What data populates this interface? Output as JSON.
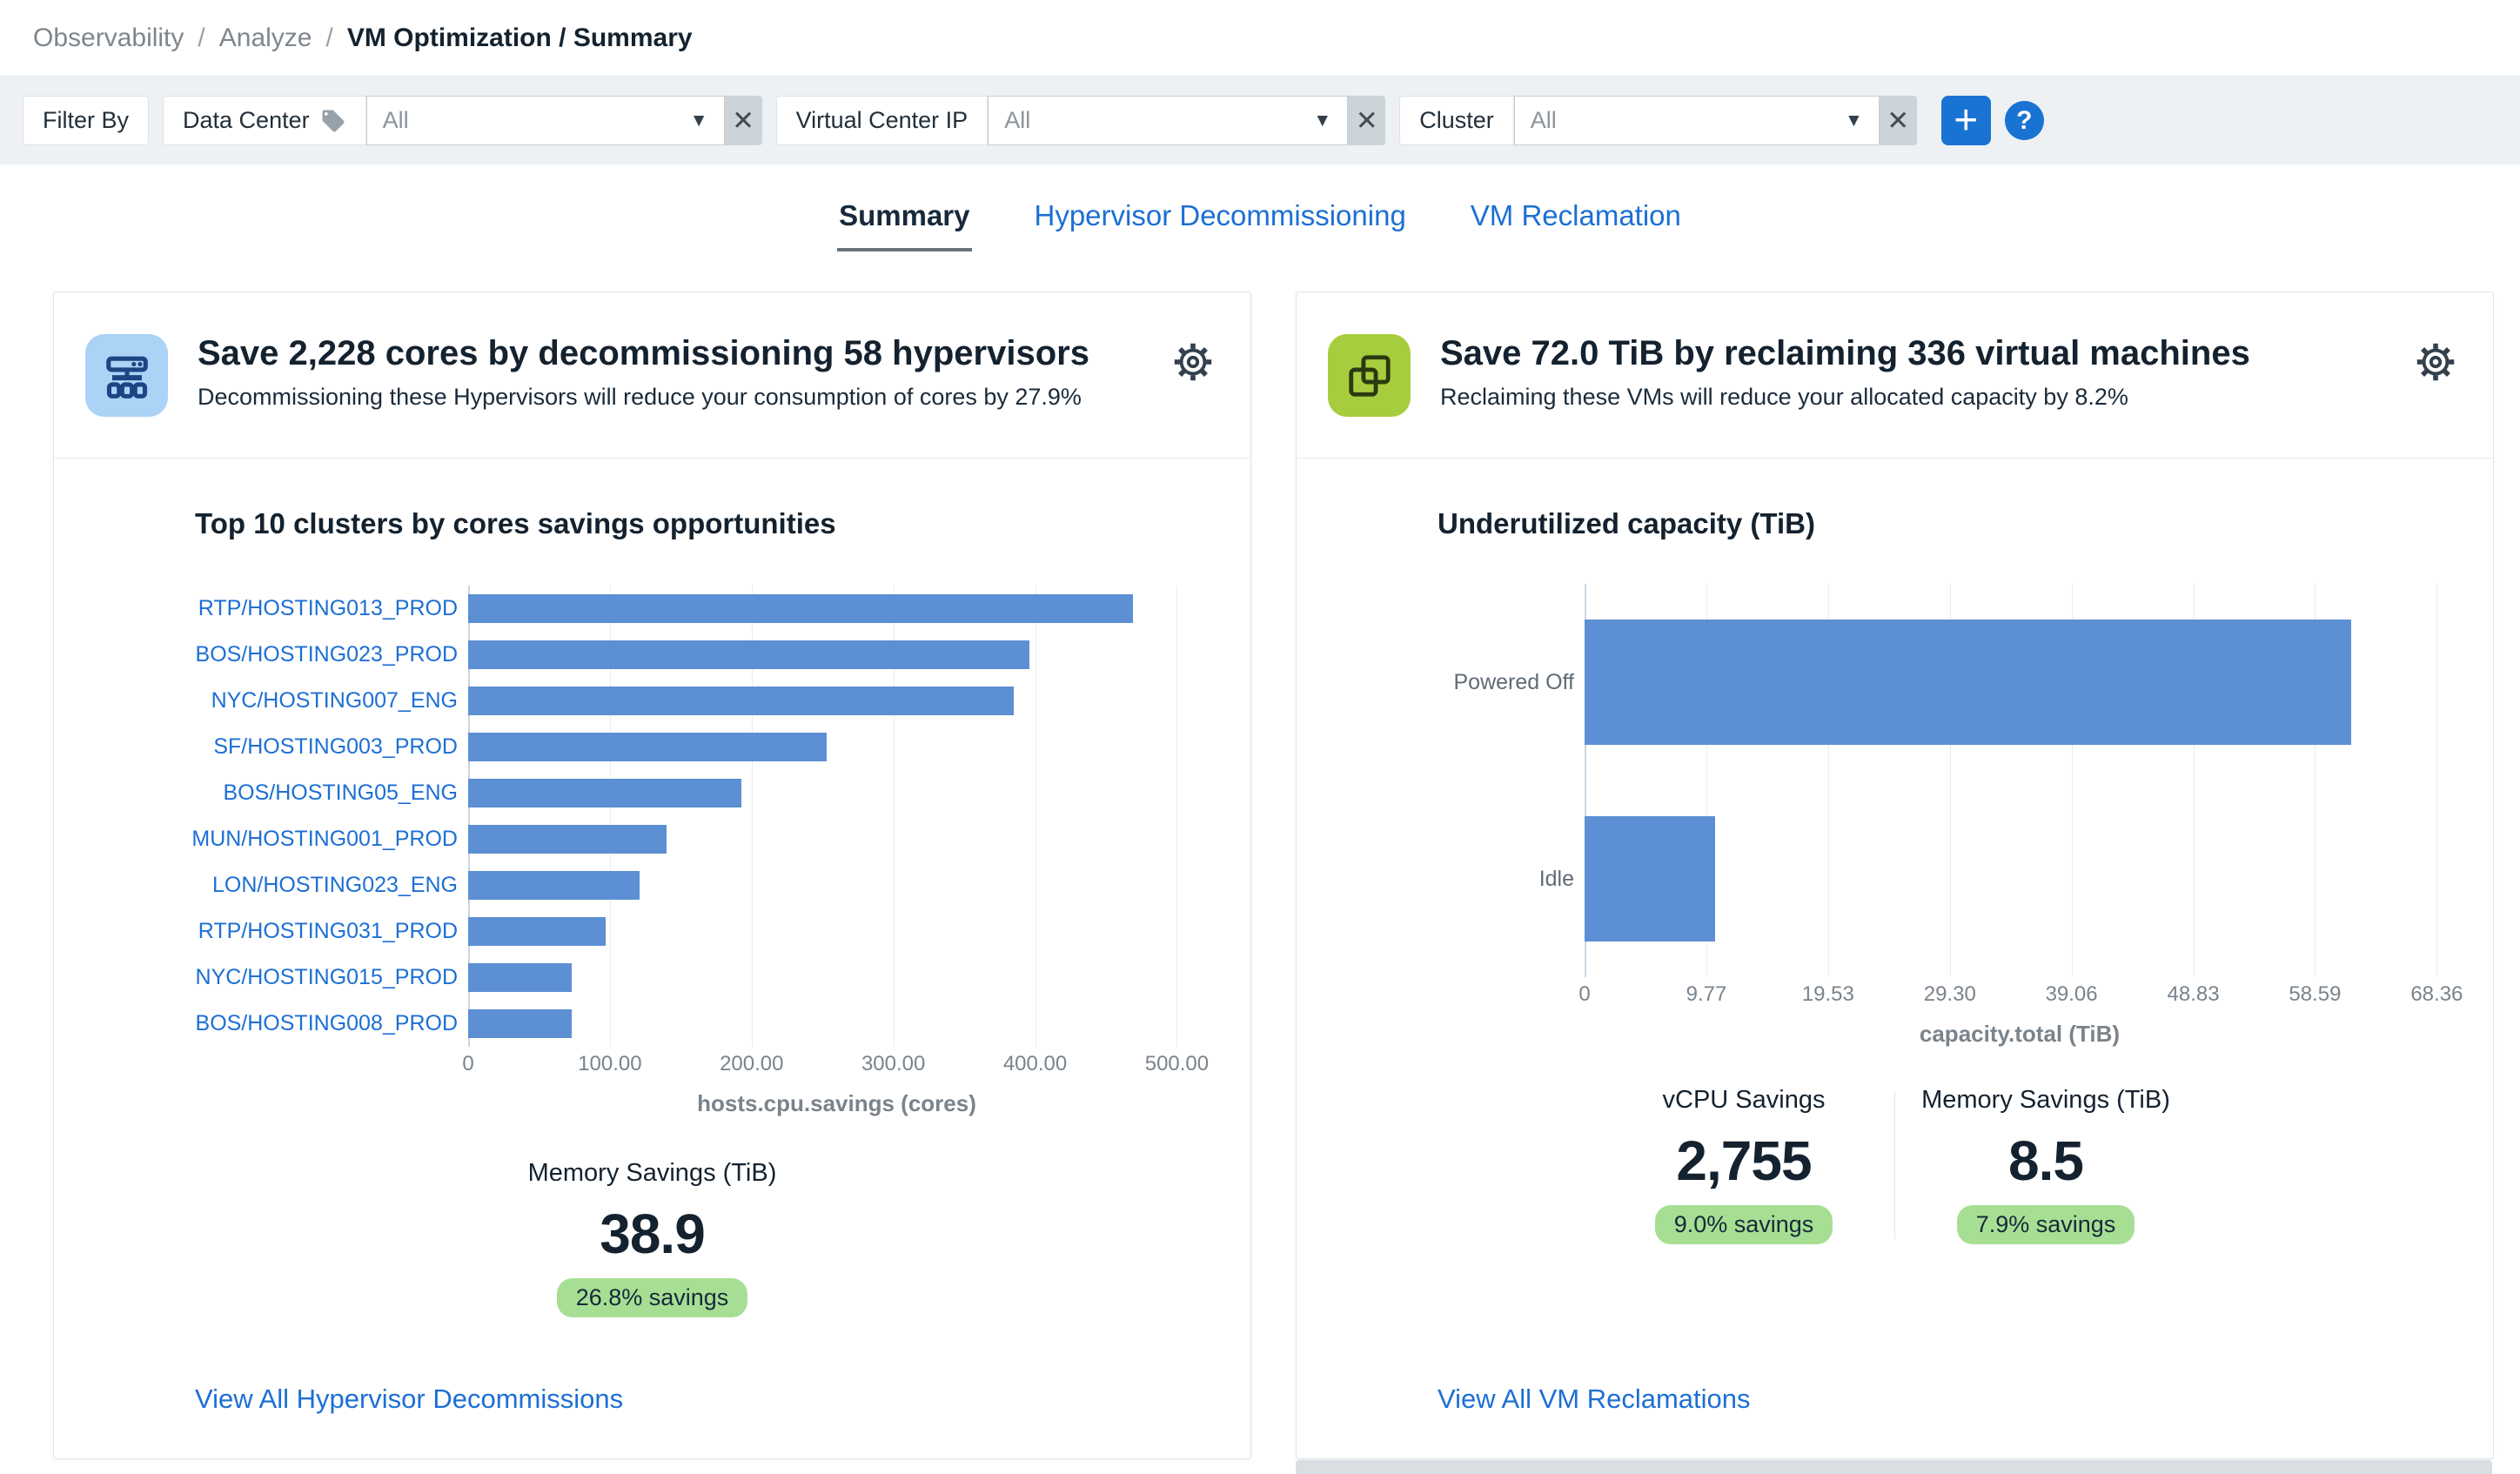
{
  "breadcrumb": {
    "separator": "/",
    "items": [
      {
        "label": "Observability"
      },
      {
        "label": "Analyze"
      }
    ],
    "current": "VM Optimization / Summary"
  },
  "icons": {
    "caret": "▼",
    "close": "✕",
    "add": "+",
    "help": "?"
  },
  "filter_bar": {
    "filter_by_label": "Filter By",
    "filters": [
      {
        "label": "Data Center",
        "value": "All"
      },
      {
        "label": "Virtual Center IP",
        "value": "All"
      },
      {
        "label": "Cluster",
        "value": "All"
      }
    ]
  },
  "tabs": [
    {
      "label": "Summary",
      "active": true
    },
    {
      "label": "Hypervisor Decommissioning",
      "active": false
    },
    {
      "label": "VM Reclamation",
      "active": false
    }
  ],
  "cards": {
    "hypervisor": {
      "title": "Save 2,228 cores by decommissioning 58 hypervisors",
      "subtitle": "Decommissioning these Hypervisors will reduce your consumption of cores by 27.9%",
      "kpis": [
        {
          "label": "Memory Savings (TiB)",
          "value": "38.9",
          "badge": "26.8% savings"
        }
      ],
      "link": "View All Hypervisor Decommissions"
    },
    "vm": {
      "title": "Save 72.0 TiB by reclaiming 336 virtual machines",
      "subtitle": "Reclaiming these VMs will reduce your allocated capacity by 8.2%",
      "kpis": [
        {
          "label": "vCPU Savings",
          "value": "2,755",
          "badge": "9.0% savings"
        },
        {
          "label": "Memory Savings (TiB)",
          "value": "8.5",
          "badge": "7.9% savings"
        }
      ],
      "link": "View All VM Reclamations"
    }
  },
  "chart_data": [
    {
      "type": "bar",
      "orientation": "horizontal",
      "title": "Top 10 clusters by cores savings opportunities",
      "categories": [
        "RTP/HOSTING013_PROD",
        "BOS/HOSTING023_PROD",
        "NYC/HOSTING007_ENG",
        "SF/HOSTING003_PROD",
        "BOS/HOSTING05_ENG",
        "MUN/HOSTING001_PROD",
        "LON/HOSTING023_ENG",
        "RTP/HOSTING031_PROD",
        "NYC/HOSTING015_PROD",
        "BOS/HOSTING008_PROD"
      ],
      "values": [
        469,
        396,
        385,
        253,
        193,
        140,
        121,
        97,
        73,
        73
      ],
      "xlabel": "hosts.cpu.savings (cores)",
      "xticks": [
        0,
        100,
        200,
        300,
        400,
        500
      ],
      "xtick_labels": [
        "0",
        "100.00",
        "200.00",
        "300.00",
        "400.00",
        "500.00"
      ],
      "xlim": [
        0,
        520
      ],
      "grid": true,
      "legend": "none",
      "label_style": "link",
      "bar_color": "#5c8fd3"
    },
    {
      "type": "bar",
      "orientation": "horizontal",
      "title": "Underutilized capacity (TiB)",
      "categories": [
        "Powered Off",
        "Idle"
      ],
      "values": [
        61.5,
        10.5
      ],
      "xlabel": "capacity.total (TiB)",
      "xticks": [
        0,
        9.77,
        19.53,
        29.3,
        39.06,
        48.83,
        58.59,
        68.36
      ],
      "xtick_labels": [
        "0",
        "9.77",
        "19.53",
        "29.30",
        "39.06",
        "48.83",
        "58.59",
        "68.36"
      ],
      "xlim": [
        0,
        69.8
      ],
      "grid": true,
      "legend": "none",
      "label_style": "plain",
      "bar_color": "#5c8fd3"
    }
  ],
  "colors": {
    "accent_blue": "#1973d3",
    "link_blue": "#1c6fd4",
    "bar_blue": "#5c8fd3",
    "badge_green": "#a6df93",
    "icon_blue_bg": "#abd3f6",
    "icon_green_bg": "#a6cd3e",
    "filter_strip_bg": "#edf1f4"
  }
}
